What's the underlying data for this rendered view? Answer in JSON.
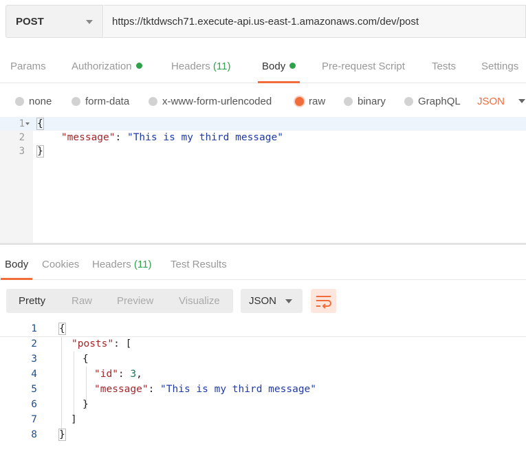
{
  "request": {
    "method": "POST",
    "url": "https://tktdwsch71.execute-api.us-east-1.amazonaws.com/dev/post"
  },
  "request_tabs": {
    "params": "Params",
    "authorization": "Authorization",
    "headers": "Headers",
    "headers_count": "(11)",
    "body": "Body",
    "prerequest": "Pre-request Script",
    "tests": "Tests",
    "settings": "Settings",
    "active": "Body",
    "indicator_color": "#2ea24a"
  },
  "body_types": {
    "none": "none",
    "form_data": "form-data",
    "urlencoded": "x-www-form-urlencoded",
    "raw": "raw",
    "binary": "binary",
    "graphql": "GraphQL",
    "selected": "raw",
    "format": "JSON"
  },
  "request_editor": {
    "line_numbers": [
      "1",
      "2",
      "3"
    ],
    "line1_code": "{",
    "line2_indent": "    ",
    "line2_key": "\"message\"",
    "line2_colon": ": ",
    "line2_value": "\"This is my third message\"",
    "line3_code": "}"
  },
  "response_tabs": {
    "body": "Body",
    "cookies": "Cookies",
    "headers": "Headers",
    "headers_count": "(11)",
    "test_results": "Test Results",
    "active": "Body"
  },
  "response_toolbar": {
    "pretty": "Pretty",
    "raw": "Raw",
    "preview": "Preview",
    "visualize": "Visualize",
    "active": "Pretty",
    "format": "JSON",
    "wrap_icon": "wrap-lines-icon"
  },
  "response_body": {
    "line_numbers": [
      "1",
      "2",
      "3",
      "4",
      "5",
      "6",
      "7",
      "8"
    ],
    "l1": "{",
    "l2_key": "\"posts\"",
    "l2_rest": ": [",
    "l3": "{",
    "l4_key": "\"id\"",
    "l4_colon": ": ",
    "l4_value": "3",
    "l4_comma": ",",
    "l5_key": "\"message\"",
    "l5_colon": ": ",
    "l5_value": "\"This is my third message\"",
    "l6": "}",
    "l7": "]",
    "l8": "}"
  },
  "colors": {
    "accent": "#f26b3a",
    "green": "#2ea24a",
    "json_key": "#a3262b",
    "json_string": "#1f3aa8",
    "json_number": "#1a7a55"
  }
}
